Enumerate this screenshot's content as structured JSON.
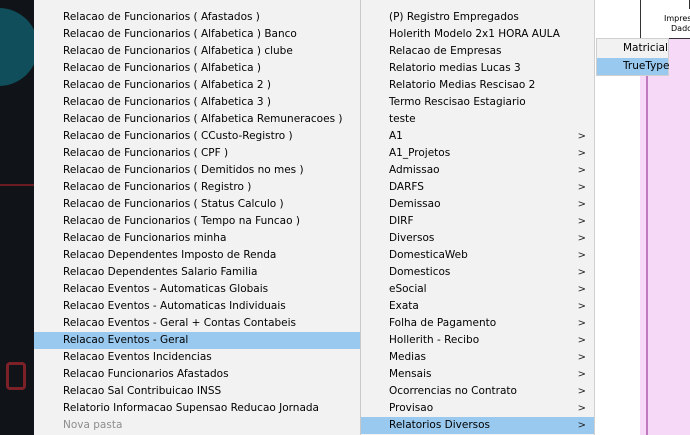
{
  "menu_left": [
    {
      "label": "Relacao de Funcionarios ( Afastados )"
    },
    {
      "label": "Relacao de Funcionarios ( Alfabetica ) Banco"
    },
    {
      "label": "Relacao de Funcionarios ( Alfabetica ) clube"
    },
    {
      "label": "Relacao de Funcionarios ( Alfabetica )"
    },
    {
      "label": "Relacao de Funcionarios ( Alfabetica 2 )"
    },
    {
      "label": "Relacao de Funcionarios ( Alfabetica 3 )"
    },
    {
      "label": "Relacao de Funcionarios ( Alfabetica Remuneracoes )"
    },
    {
      "label": "Relacao de Funcionarios ( CCusto-Registro )"
    },
    {
      "label": "Relacao de Funcionarios ( CPF )"
    },
    {
      "label": "Relacao de Funcionarios ( Demitidos no mes )"
    },
    {
      "label": "Relacao de Funcionarios ( Registro )"
    },
    {
      "label": "Relacao de Funcionarios ( Status Calculo )"
    },
    {
      "label": "Relacao de Funcionarios ( Tempo na Funcao )"
    },
    {
      "label": "Relacao de Funcionarios minha"
    },
    {
      "label": "Relacao Dependentes Imposto de Renda"
    },
    {
      "label": "Relacao Dependentes Salario Familia"
    },
    {
      "label": "Relacao Eventos - Automaticas Globais"
    },
    {
      "label": "Relacao Eventos - Automaticas Individuais"
    },
    {
      "label": "Relacao Eventos - Geral + Contas Contabeis"
    },
    {
      "label": "Relacao Eventos - Geral",
      "highlighted": true
    },
    {
      "label": "Relacao Eventos Incidencias"
    },
    {
      "label": "Relacao Funcionarios Afastados"
    },
    {
      "label": "Relacao Sal Contribuicao INSS"
    },
    {
      "label": "Relatorio Informacao Supensao Reducao Jornada"
    },
    {
      "label": "Nova pasta",
      "dimmed": true
    }
  ],
  "menu_right": [
    {
      "label": "(P) Registro Empregados",
      "submenu": false
    },
    {
      "label": "Holerith Modelo 2x1 HORA AULA",
      "submenu": false
    },
    {
      "label": "Relacao de Empresas",
      "submenu": false
    },
    {
      "label": "Relatorio medias Lucas 3",
      "submenu": false
    },
    {
      "label": "Relatorio Medias Rescisao 2",
      "submenu": false
    },
    {
      "label": "Termo Rescisao Estagiario",
      "submenu": false
    },
    {
      "label": "teste",
      "submenu": false
    },
    {
      "label": "A1",
      "submenu": true
    },
    {
      "label": "A1_Projetos",
      "submenu": true
    },
    {
      "label": "Admissao",
      "submenu": true
    },
    {
      "label": "DARFS",
      "submenu": true
    },
    {
      "label": "Demissao",
      "submenu": true
    },
    {
      "label": "DIRF",
      "submenu": true
    },
    {
      "label": "Diversos",
      "submenu": true
    },
    {
      "label": "DomesticaWeb",
      "submenu": true
    },
    {
      "label": "Domesticos",
      "submenu": true
    },
    {
      "label": "eSocial",
      "submenu": true
    },
    {
      "label": "Exata",
      "submenu": true
    },
    {
      "label": "Folha de Pagamento",
      "submenu": true
    },
    {
      "label": "Hollerith - Recibo",
      "submenu": true
    },
    {
      "label": "Medias",
      "submenu": true
    },
    {
      "label": "Mensais",
      "submenu": true
    },
    {
      "label": "Ocorrencias no Contrato",
      "submenu": true
    },
    {
      "label": "Provisao",
      "submenu": true
    },
    {
      "label": "Relatorios Diversos",
      "submenu": true,
      "highlighted": true
    }
  ],
  "submenu_arrow_glyph": ">",
  "submenu_print": {
    "items": [
      {
        "label": "Matricial"
      },
      {
        "label": "TrueType",
        "highlighted": true
      }
    ]
  },
  "right_window": {
    "label_line1": "Impressã",
    "label_line2": "Dado"
  },
  "colors": {
    "menu_bg": "#f2f2f2",
    "highlight": "#99c9ef",
    "right_panel": "#f6d9f6"
  }
}
